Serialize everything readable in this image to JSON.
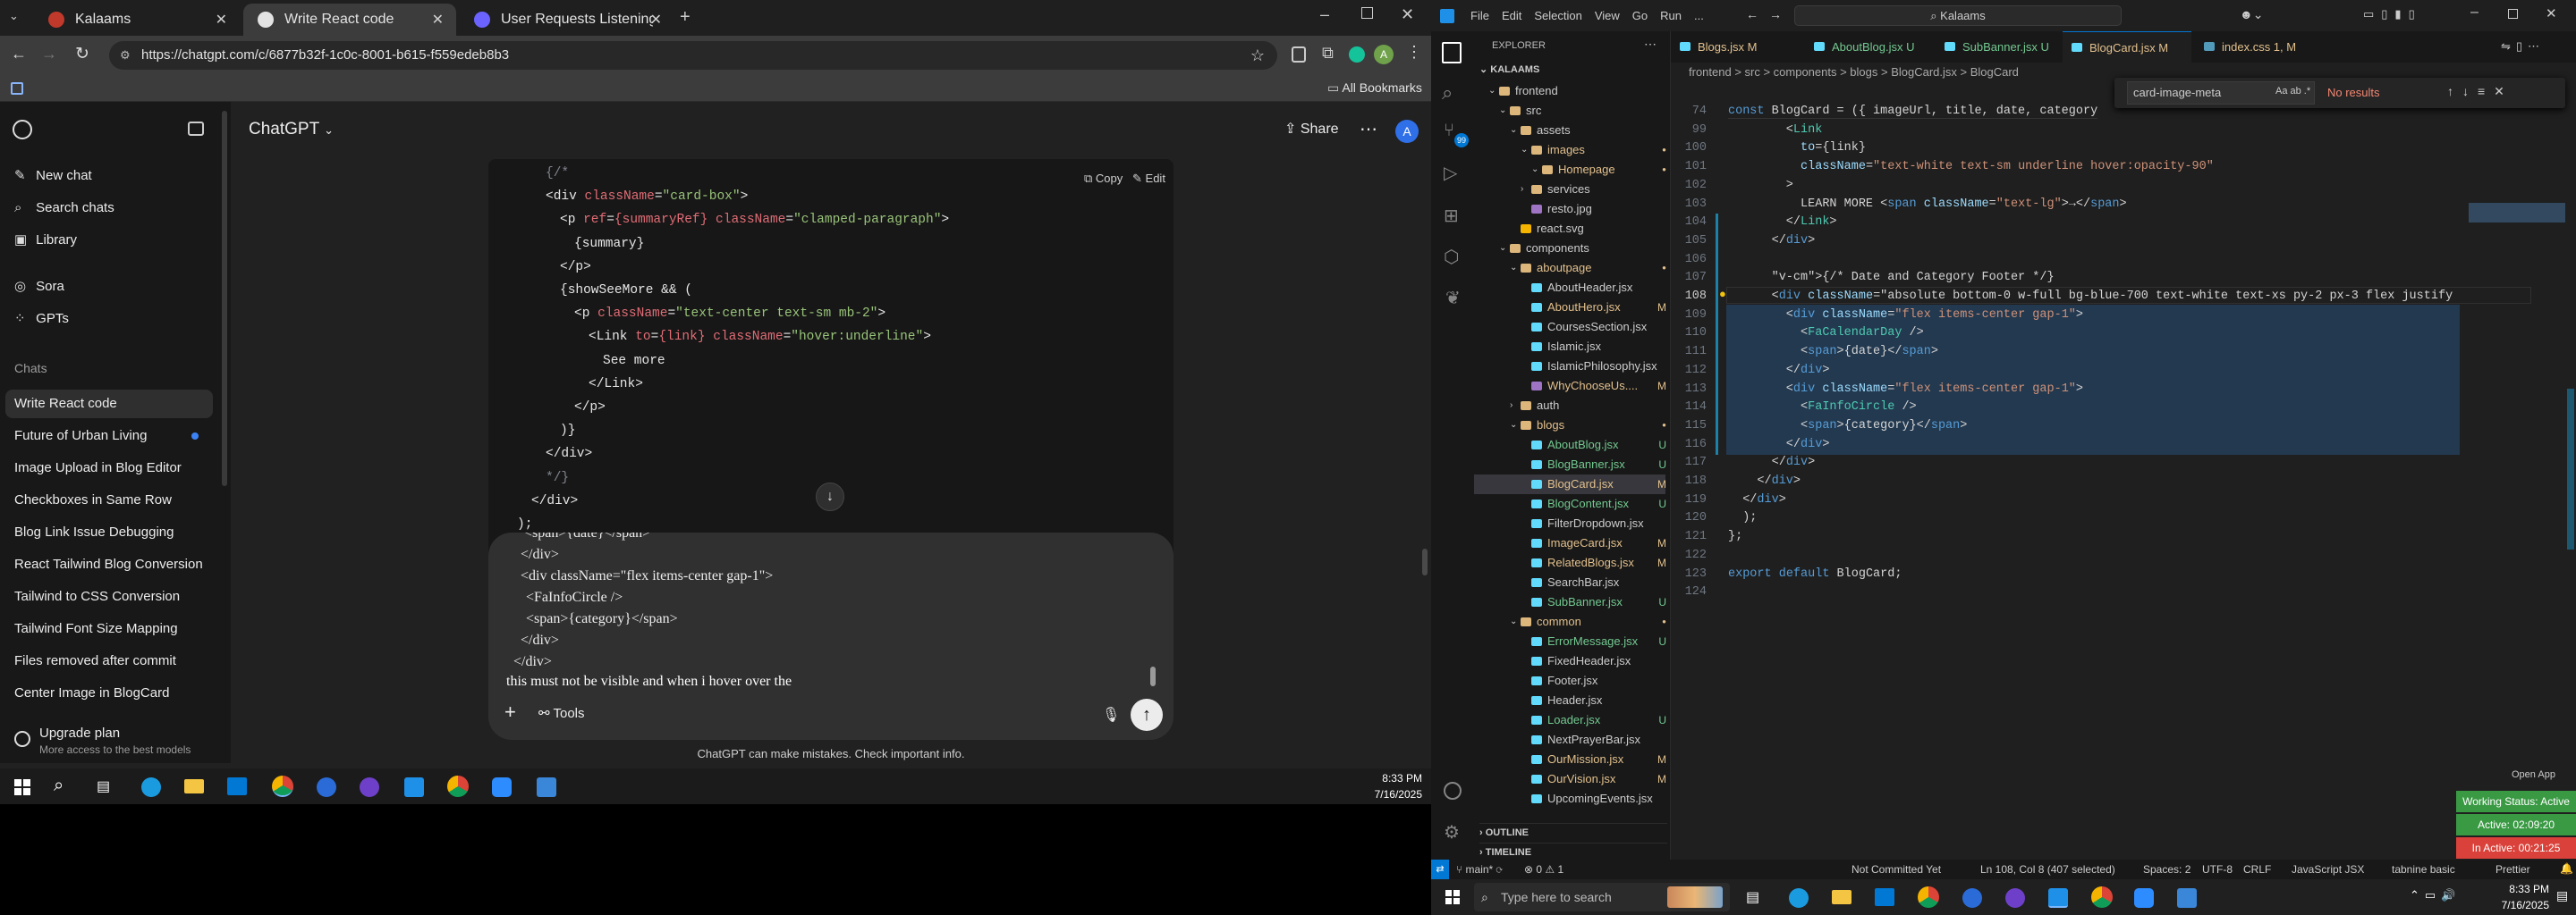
{
  "browser": {
    "tabs": [
      {
        "label": "Kalaams",
        "color": "#c0392b"
      },
      {
        "label": "Write React code",
        "color": "#e3e3e3"
      },
      {
        "label": "User Requests Listening Assista",
        "color": "#6c63ff"
      }
    ],
    "url": "https://chatgpt.com/c/6877b32f-1c0c-8001-b615-f559edeb8b3",
    "all_bookmarks": "All Bookmarks"
  },
  "chatgpt": {
    "model_label": "ChatGPT",
    "share_label": "Share",
    "avatar_letter": "A",
    "sidebar": {
      "top_items": [
        {
          "icon": "new-chat-icon",
          "label": "New chat"
        },
        {
          "icon": "search-icon",
          "label": "Search chats"
        },
        {
          "icon": "library-icon",
          "label": "Library"
        },
        {
          "icon": "sora-icon",
          "label": "Sora"
        },
        {
          "icon": "gpts-icon",
          "label": "GPTs"
        }
      ],
      "chats_heading": "Chats",
      "chats": [
        "Write React code",
        "Future of Urban Living",
        "Image Upload in Blog Editor",
        "Checkboxes in Same Row",
        "Blog Link Issue Debugging",
        "React Tailwind Blog Conversion",
        "Tailwind to CSS Conversion",
        "Tailwind Font Size Mapping",
        "Files removed after commit",
        "Center Image in BlogCard"
      ],
      "upgrade_title": "Upgrade plan",
      "upgrade_sub": "More access to the best models"
    },
    "code_actions": {
      "copy": "Copy",
      "edit": "Edit"
    },
    "code_lines": [
      {
        "indent": 3,
        "parts": [
          [
            "c",
            "{/*"
          ]
        ]
      },
      {
        "indent": 3,
        "parts": [
          [
            "t",
            "<div "
          ],
          [
            "a",
            "className"
          ],
          [
            "t",
            "="
          ],
          [
            "s",
            "\"card-box\""
          ],
          [
            "t",
            ">"
          ]
        ]
      },
      {
        "indent": 4,
        "parts": [
          [
            "t",
            "<p "
          ],
          [
            "a",
            "ref"
          ],
          [
            "t",
            "="
          ],
          [
            "a",
            "{summaryRef}"
          ],
          [
            "t",
            " "
          ],
          [
            "a",
            "className"
          ],
          [
            "t",
            "="
          ],
          [
            "s",
            "\"clamped-paragraph\""
          ],
          [
            "t",
            ">"
          ]
        ]
      },
      {
        "indent": 5,
        "parts": [
          [
            "t",
            "{summary}"
          ]
        ]
      },
      {
        "indent": 4,
        "parts": [
          [
            "t",
            "</p>"
          ]
        ]
      },
      {
        "indent": 4,
        "parts": [
          [
            "t",
            "{showSeeMore && ("
          ]
        ]
      },
      {
        "indent": 5,
        "parts": [
          [
            "t",
            "<p "
          ],
          [
            "a",
            "className"
          ],
          [
            "t",
            "="
          ],
          [
            "s",
            "\"text-center text-sm mb-2\""
          ],
          [
            "t",
            ">"
          ]
        ]
      },
      {
        "indent": 6,
        "parts": [
          [
            "t",
            "<Link "
          ],
          [
            "a",
            "to"
          ],
          [
            "t",
            "="
          ],
          [
            "a",
            "{link}"
          ],
          [
            "t",
            " "
          ],
          [
            "a",
            "className"
          ],
          [
            "t",
            "="
          ],
          [
            "s",
            "\"hover:underline\""
          ],
          [
            "t",
            ">"
          ]
        ]
      },
      {
        "indent": 7,
        "parts": [
          [
            "t",
            "See more"
          ]
        ]
      },
      {
        "indent": 6,
        "parts": [
          [
            "t",
            "</Link>"
          ]
        ]
      },
      {
        "indent": 5,
        "parts": [
          [
            "t",
            "</p>"
          ]
        ]
      },
      {
        "indent": 4,
        "parts": [
          [
            "t",
            ")}"
          ]
        ]
      },
      {
        "indent": 3,
        "parts": [
          [
            "t",
            "</div>"
          ]
        ]
      },
      {
        "indent": 3,
        "parts": [
          [
            "c",
            "*/}"
          ]
        ]
      },
      {
        "indent": 2,
        "parts": [
          [
            "t",
            "</div>"
          ]
        ]
      },
      {
        "indent": 1,
        "parts": [
          [
            "t",
            ");"
          ]
        ]
      },
      {
        "indent": 0,
        "parts": [
          [
            "t",
            "};"
          ]
        ]
      }
    ],
    "composer_lines": [
      "<span>{date}</span>",
      "</div>",
      "<div className=\"flex items-center gap-1\">",
      "<FaInfoCircle />",
      "<span>{category}</span>",
      "</div>",
      "</div>"
    ],
    "composer_prompt": "this must not be visible and when i hover over the",
    "tools_label": "Tools",
    "disclaimer": "ChatGPT can make mistakes. Check important info."
  },
  "taskbar_left": {
    "time": "8:33 PM",
    "date": "7/16/2025"
  },
  "vscode": {
    "search_box": "Kalaams",
    "menu": [
      "File",
      "Edit",
      "Selection",
      "View",
      "Go",
      "Run",
      "..."
    ],
    "explorer_title": "EXPLORER",
    "project": "KALAAMS",
    "tree": [
      {
        "depth": 1,
        "type": "folder",
        "name": "frontend",
        "badge": "",
        "color": "#cccccc"
      },
      {
        "depth": 2,
        "type": "folder",
        "name": "src",
        "badge": "",
        "color": "#cccccc"
      },
      {
        "depth": 3,
        "type": "folder",
        "name": "assets",
        "badge": "",
        "color": "#cccccc"
      },
      {
        "depth": 4,
        "type": "folder",
        "name": "images",
        "badge": "",
        "color": "#e2c08d"
      },
      {
        "depth": 5,
        "type": "folder",
        "name": "Homepage",
        "badge": "",
        "color": "#e2c08d"
      },
      {
        "depth": 4,
        "type": "folder",
        "name": "services",
        "badge": "",
        "color": "#cccccc"
      },
      {
        "depth": 4,
        "type": "file",
        "name": "resto.jpg",
        "badge": "",
        "color": "#cccccc"
      },
      {
        "depth": 3,
        "type": "file",
        "name": "react.svg",
        "badge": "",
        "color": "#cccccc"
      },
      {
        "depth": 2,
        "type": "folder",
        "name": "components",
        "badge": "",
        "color": "#cccccc"
      },
      {
        "depth": 3,
        "type": "folder",
        "name": "aboutpage",
        "badge": "",
        "color": "#e2c08d"
      },
      {
        "depth": 4,
        "type": "file",
        "name": "AboutHeader.jsx",
        "badge": "",
        "color": "#cccccc"
      },
      {
        "depth": 4,
        "type": "file",
        "name": "AboutHero.jsx",
        "badge": "M",
        "color": "#e2c08d"
      },
      {
        "depth": 4,
        "type": "file",
        "name": "CoursesSection.jsx",
        "badge": "",
        "color": "#cccccc"
      },
      {
        "depth": 4,
        "type": "file",
        "name": "Islamic.jsx",
        "badge": "",
        "color": "#cccccc"
      },
      {
        "depth": 4,
        "type": "file",
        "name": "IslamicPhilosophy.jsx",
        "badge": "",
        "color": "#cccccc"
      },
      {
        "depth": 4,
        "type": "file",
        "name": "WhyChooseUs....",
        "badge": "M",
        "color": "#e2c08d"
      },
      {
        "depth": 3,
        "type": "folder",
        "name": "auth",
        "badge": "",
        "color": "#cccccc"
      },
      {
        "depth": 3,
        "type": "folder",
        "name": "blogs",
        "badge": "",
        "color": "#e2c08d"
      },
      {
        "depth": 4,
        "type": "file",
        "name": "AboutBlog.jsx",
        "badge": "U",
        "color": "#73c991"
      },
      {
        "depth": 4,
        "type": "file",
        "name": "BlogBanner.jsx",
        "badge": "U",
        "color": "#73c991"
      },
      {
        "depth": 4,
        "type": "file",
        "name": "BlogCard.jsx",
        "badge": "M",
        "color": "#e2c08d"
      },
      {
        "depth": 4,
        "type": "file",
        "name": "BlogContent.jsx",
        "badge": "U",
        "color": "#73c991"
      },
      {
        "depth": 4,
        "type": "file",
        "name": "FilterDropdown.jsx",
        "badge": "",
        "color": "#cccccc"
      },
      {
        "depth": 4,
        "type": "file",
        "name": "ImageCard.jsx",
        "badge": "M",
        "color": "#e2c08d"
      },
      {
        "depth": 4,
        "type": "file",
        "name": "RelatedBlogs.jsx",
        "badge": "M",
        "color": "#e2c08d"
      },
      {
        "depth": 4,
        "type": "file",
        "name": "SearchBar.jsx",
        "badge": "",
        "color": "#cccccc"
      },
      {
        "depth": 4,
        "type": "file",
        "name": "SubBanner.jsx",
        "badge": "U",
        "color": "#73c991"
      },
      {
        "depth": 3,
        "type": "folder",
        "name": "common",
        "badge": "",
        "color": "#e2c08d"
      },
      {
        "depth": 4,
        "type": "file",
        "name": "ErrorMessage.jsx",
        "badge": "U",
        "color": "#73c991"
      },
      {
        "depth": 4,
        "type": "file",
        "name": "FixedHeader.jsx",
        "badge": "",
        "color": "#cccccc"
      },
      {
        "depth": 4,
        "type": "file",
        "name": "Footer.jsx",
        "badge": "",
        "color": "#cccccc"
      },
      {
        "depth": 4,
        "type": "file",
        "name": "Header.jsx",
        "badge": "",
        "color": "#cccccc"
      },
      {
        "depth": 4,
        "type": "file",
        "name": "Loader.jsx",
        "badge": "U",
        "color": "#73c991"
      },
      {
        "depth": 4,
        "type": "file",
        "name": "NextPrayerBar.jsx",
        "badge": "",
        "color": "#cccccc"
      },
      {
        "depth": 4,
        "type": "file",
        "name": "OurMission.jsx",
        "badge": "M",
        "color": "#e2c08d"
      },
      {
        "depth": 4,
        "type": "file",
        "name": "OurVision.jsx",
        "badge": "M",
        "color": "#e2c08d"
      },
      {
        "depth": 4,
        "type": "file",
        "name": "UpcomingEvents.jsx",
        "badge": "",
        "color": "#cccccc"
      }
    ],
    "outline_label": "OUTLINE",
    "timeline_label": "TIMELINE",
    "editor_tabs": [
      {
        "label": "Blogs.jsx M",
        "color": "#e2c08d",
        "active": false
      },
      {
        "label": "AboutBlog.jsx U",
        "color": "#73c991",
        "active": false
      },
      {
        "label": "SubBanner.jsx U",
        "color": "#73c991",
        "active": false
      },
      {
        "label": "BlogCard.jsx M",
        "color": "#e2c08d",
        "active": true
      },
      {
        "label": "index.css 1, M",
        "color": "#e2c08d",
        "active": false
      }
    ],
    "breadcrumb": "frontend > src > components > blogs > BlogCard.jsx > BlogCard",
    "find_widget": {
      "query": "card-image-meta",
      "result": "No results"
    },
    "code": [
      {
        "n": "74",
        "t": "const BlogCard = ({ imageUrl, title, date, category"
      },
      {
        "n": "99",
        "t": "        <Link"
      },
      {
        "n": "100",
        "t": "          to={link}"
      },
      {
        "n": "101",
        "t": "          className=\"text-white text-sm underline hover:opacity-90\""
      },
      {
        "n": "102",
        "t": "        >"
      },
      {
        "n": "103",
        "t": "          LEARN MORE <span className=\"text-lg\">→</span>"
      },
      {
        "n": "104",
        "t": "        </Link>"
      },
      {
        "n": "105",
        "t": "      </div>"
      },
      {
        "n": "106",
        "t": ""
      },
      {
        "n": "107",
        "t": "      {/* Date and Category Footer */}"
      },
      {
        "n": "108",
        "t": "      <div className=\"absolute bottom-0 w-full bg-blue-700 text-white text-xs py-2 px-3 flex justify"
      },
      {
        "n": "109",
        "t": "        <div className=\"flex items-center gap-1\">"
      },
      {
        "n": "110",
        "t": "          <FaCalendarDay />"
      },
      {
        "n": "111",
        "t": "          <span>{date}</span>"
      },
      {
        "n": "112",
        "t": "        </div>"
      },
      {
        "n": "113",
        "t": "        <div className=\"flex items-center gap-1\">"
      },
      {
        "n": "114",
        "t": "          <FaInfoCircle />"
      },
      {
        "n": "115",
        "t": "          <span>{category}</span>"
      },
      {
        "n": "116",
        "t": "        </div>"
      },
      {
        "n": "117",
        "t": "      </div>"
      },
      {
        "n": "118",
        "t": "    </div>"
      },
      {
        "n": "119",
        "t": "  </div>"
      },
      {
        "n": "120",
        "t": "  );"
      },
      {
        "n": "121",
        "t": "};"
      },
      {
        "n": "122",
        "t": ""
      },
      {
        "n": "123",
        "t": "export default BlogCard;"
      },
      {
        "n": "124",
        "t": ""
      }
    ],
    "open_app": "Open App",
    "status_widget": {
      "working": "Working Status: Active",
      "active": "Active: 02:09:20",
      "inactive": "In Active: 00:21:25"
    },
    "statusbar": {
      "branch": "main*",
      "problems": "⊗ 0 ⚠ 1",
      "git": "Not Committed Yet",
      "position": "Ln 108, Col 8 (407 selected)",
      "spaces": "Spaces: 2",
      "encoding": "UTF-8",
      "eol": "CRLF",
      "language": "JavaScript JSX",
      "tabnine": "tabnine basic",
      "prettier": "Prettier"
    },
    "taskbar": {
      "search_placeholder": "Type here to search",
      "time": "8:33 PM",
      "date": "7/16/2025"
    }
  }
}
